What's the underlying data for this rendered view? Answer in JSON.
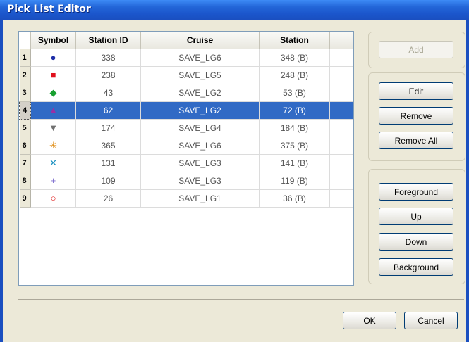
{
  "window": {
    "title": "Pick List Editor"
  },
  "table": {
    "headers": [
      "Symbol",
      "Station ID",
      "Cruise",
      "Station"
    ],
    "rows": [
      {
        "num": "1",
        "symbol": "●",
        "color": "#1f2fa8",
        "station_id": "338",
        "cruise": "SAVE_LG6",
        "station": "348 (B)",
        "icon": "circle-filled-icon"
      },
      {
        "num": "2",
        "symbol": "■",
        "color": "#e0101c",
        "station_id": "238",
        "cruise": "SAVE_LG5",
        "station": "248 (B)",
        "icon": "square-filled-icon"
      },
      {
        "num": "3",
        "symbol": "◆",
        "color": "#18a030",
        "station_id": "43",
        "cruise": "SAVE_LG2",
        "station": "53 (B)",
        "icon": "diamond-filled-icon"
      },
      {
        "num": "4",
        "symbol": "▲",
        "color": "#9a2fa5",
        "station_id": "62",
        "cruise": "SAVE_LG2",
        "station": "72 (B)",
        "icon": "triangle-up-icon"
      },
      {
        "num": "5",
        "symbol": "▼",
        "color": "#707070",
        "station_id": "174",
        "cruise": "SAVE_LG4",
        "station": "184 (B)",
        "icon": "triangle-down-icon"
      },
      {
        "num": "6",
        "symbol": "✳",
        "color": "#e0901c",
        "station_id": "365",
        "cruise": "SAVE_LG6",
        "station": "375 (B)",
        "icon": "asterisk-icon"
      },
      {
        "num": "7",
        "symbol": "✕",
        "color": "#1a90c0",
        "station_id": "131",
        "cruise": "SAVE_LG3",
        "station": "141 (B)",
        "icon": "cross-x-icon"
      },
      {
        "num": "8",
        "symbol": "+",
        "color": "#7f6fcf",
        "station_id": "109",
        "cruise": "SAVE_LG3",
        "station": "119 (B)",
        "icon": "plus-icon"
      },
      {
        "num": "9",
        "symbol": "○",
        "color": "#e02020",
        "station_id": "26",
        "cruise": "SAVE_LG1",
        "station": "36 (B)",
        "icon": "circle-open-icon"
      }
    ],
    "selected_row": 4
  },
  "buttons": {
    "add": "Add",
    "edit": "Edit",
    "remove": "Remove",
    "remove_all": "Remove All",
    "foreground": "Foreground",
    "up": "Up",
    "down": "Down",
    "background": "Background",
    "ok": "OK",
    "cancel": "Cancel"
  }
}
